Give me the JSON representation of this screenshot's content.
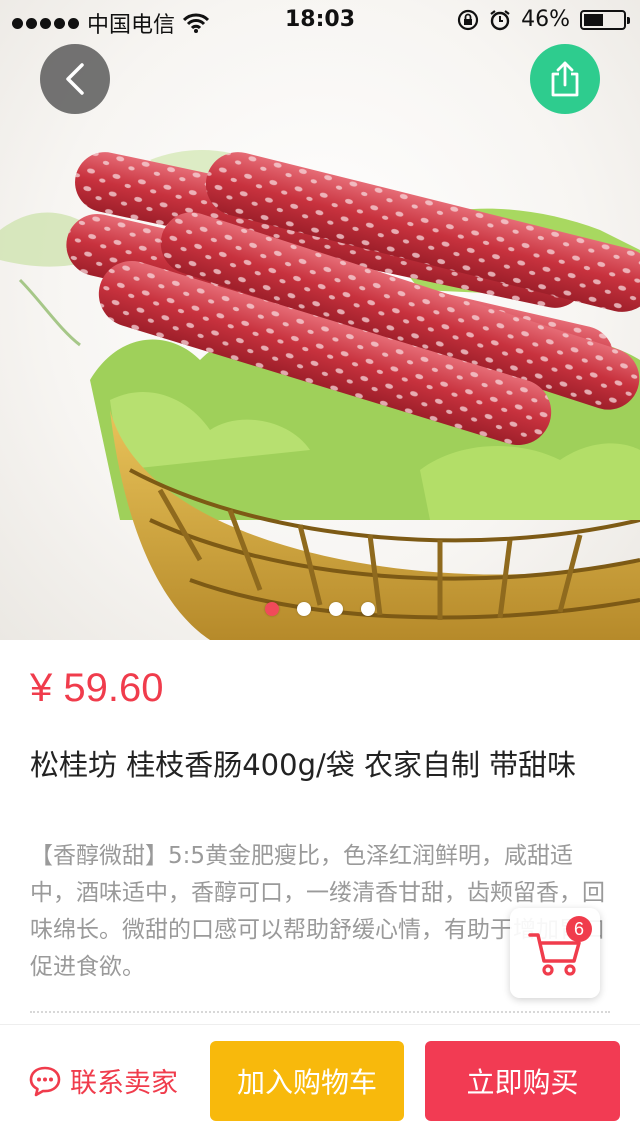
{
  "status_bar": {
    "carrier": "中国电信",
    "time": "18:03",
    "battery_percent_text": "46%",
    "battery_level": 0.46
  },
  "hero": {
    "image_subject": "sausages-in-basket",
    "slides_total": 4,
    "active_slide": 0
  },
  "icons": {
    "back": "chevron-left-icon",
    "share": "share-icon",
    "cart": "shopping-cart-icon",
    "contact": "chat-bubble-icon"
  },
  "product": {
    "price": "¥ 59.60",
    "title": "松桂坊 桂枝香肠400g/袋 农家自制 带甜味",
    "description": "【香醇微甜】5:5黄金肥瘦比，色泽红润鲜明，咸甜适中，酒味适中，香醇可口，一缕清香甘甜，齿颊留香，回味绵长。微甜的口感可以帮助舒缓心情，有助于增加胃口促进食欲。"
  },
  "cart": {
    "count": "6"
  },
  "actions": {
    "contact_label": "联系卖家",
    "add_to_cart_label": "加入购物车",
    "buy_now_label": "立即购买"
  },
  "colors": {
    "accent_red": "#f03c4c",
    "add_cart_yellow": "#f8b90c",
    "buy_red": "#f23b53",
    "share_green": "#2ecc8e",
    "back_gray": "#5a5a5a"
  }
}
